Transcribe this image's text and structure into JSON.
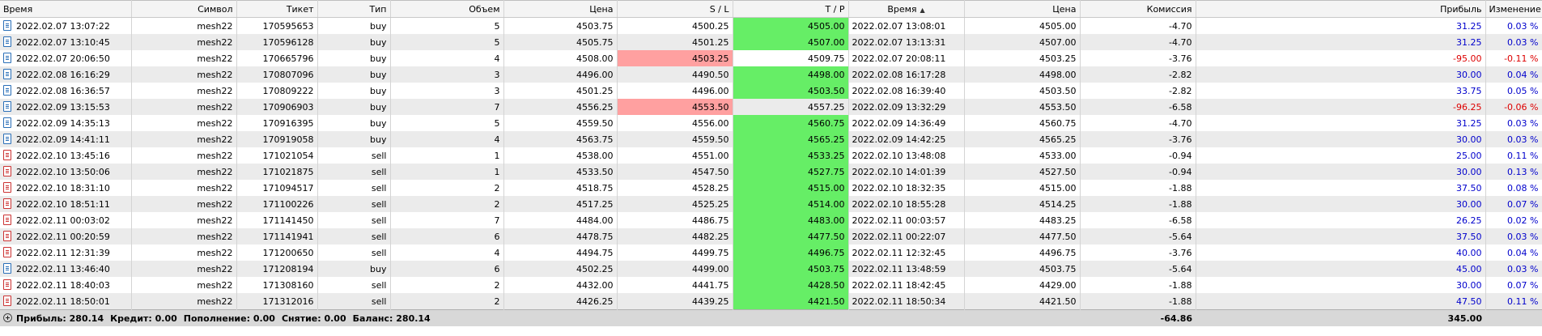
{
  "columns": {
    "time_open": "Время",
    "symbol": "Символ",
    "ticket": "Тикет",
    "type": "Тип",
    "volume": "Объем",
    "price_open": "Цена",
    "sl": "S / L",
    "tp": "T / P",
    "time_close": "Время",
    "price_close": "Цена",
    "commission": "Комиссия",
    "profit": "Прибыль",
    "change": "Изменение"
  },
  "sort": {
    "column": "time_close",
    "direction": "up",
    "icon": "sort-up-icon"
  },
  "rows": [
    {
      "time_open": "2022.02.07 13:07:22",
      "symbol": "mesh22",
      "ticket": "170595653",
      "type": "buy",
      "volume": "5",
      "price_open": "4503.75",
      "sl": "4500.25",
      "tp": "4505.00",
      "time_close": "2022.02.07 13:08:01",
      "price_close": "4505.00",
      "commission": "-4.70",
      "profit": "31.25",
      "change": "0.03 %",
      "hit": "tp"
    },
    {
      "time_open": "2022.02.07 13:10:45",
      "symbol": "mesh22",
      "ticket": "170596128",
      "type": "buy",
      "volume": "5",
      "price_open": "4505.75",
      "sl": "4501.25",
      "tp": "4507.00",
      "time_close": "2022.02.07 13:13:31",
      "price_close": "4507.00",
      "commission": "-4.70",
      "profit": "31.25",
      "change": "0.03 %",
      "hit": "tp"
    },
    {
      "time_open": "2022.02.07 20:06:50",
      "symbol": "mesh22",
      "ticket": "170665796",
      "type": "buy",
      "volume": "4",
      "price_open": "4508.00",
      "sl": "4503.25",
      "tp": "4509.75",
      "time_close": "2022.02.07 20:08:11",
      "price_close": "4503.25",
      "commission": "-3.76",
      "profit": "-95.00",
      "change": "-0.11 %",
      "hit": "sl"
    },
    {
      "time_open": "2022.02.08 16:16:29",
      "symbol": "mesh22",
      "ticket": "170807096",
      "type": "buy",
      "volume": "3",
      "price_open": "4496.00",
      "sl": "4490.50",
      "tp": "4498.00",
      "time_close": "2022.02.08 16:17:28",
      "price_close": "4498.00",
      "commission": "-2.82",
      "profit": "30.00",
      "change": "0.04 %",
      "hit": "tp"
    },
    {
      "time_open": "2022.02.08 16:36:57",
      "symbol": "mesh22",
      "ticket": "170809222",
      "type": "buy",
      "volume": "3",
      "price_open": "4501.25",
      "sl": "4496.00",
      "tp": "4503.50",
      "time_close": "2022.02.08 16:39:40",
      "price_close": "4503.50",
      "commission": "-2.82",
      "profit": "33.75",
      "change": "0.05 %",
      "hit": "tp"
    },
    {
      "time_open": "2022.02.09 13:15:53",
      "symbol": "mesh22",
      "ticket": "170906903",
      "type": "buy",
      "volume": "7",
      "price_open": "4556.25",
      "sl": "4553.50",
      "tp": "4557.25",
      "time_close": "2022.02.09 13:32:29",
      "price_close": "4553.50",
      "commission": "-6.58",
      "profit": "-96.25",
      "change": "-0.06 %",
      "hit": "sl"
    },
    {
      "time_open": "2022.02.09 14:35:13",
      "symbol": "mesh22",
      "ticket": "170916395",
      "type": "buy",
      "volume": "5",
      "price_open": "4559.50",
      "sl": "4556.00",
      "tp": "4560.75",
      "time_close": "2022.02.09 14:36:49",
      "price_close": "4560.75",
      "commission": "-4.70",
      "profit": "31.25",
      "change": "0.03 %",
      "hit": "tp"
    },
    {
      "time_open": "2022.02.09 14:41:11",
      "symbol": "mesh22",
      "ticket": "170919058",
      "type": "buy",
      "volume": "4",
      "price_open": "4563.75",
      "sl": "4559.50",
      "tp": "4565.25",
      "time_close": "2022.02.09 14:42:25",
      "price_close": "4565.25",
      "commission": "-3.76",
      "profit": "30.00",
      "change": "0.03 %",
      "hit": "tp"
    },
    {
      "time_open": "2022.02.10 13:45:16",
      "symbol": "mesh22",
      "ticket": "171021054",
      "type": "sell",
      "volume": "1",
      "price_open": "4538.00",
      "sl": "4551.00",
      "tp": "4533.25",
      "time_close": "2022.02.10 13:48:08",
      "price_close": "4533.00",
      "commission": "-0.94",
      "profit": "25.00",
      "change": "0.11 %",
      "hit": "tp"
    },
    {
      "time_open": "2022.02.10 13:50:06",
      "symbol": "mesh22",
      "ticket": "171021875",
      "type": "sell",
      "volume": "1",
      "price_open": "4533.50",
      "sl": "4547.50",
      "tp": "4527.75",
      "time_close": "2022.02.10 14:01:39",
      "price_close": "4527.50",
      "commission": "-0.94",
      "profit": "30.00",
      "change": "0.13 %",
      "hit": "tp"
    },
    {
      "time_open": "2022.02.10 18:31:10",
      "symbol": "mesh22",
      "ticket": "171094517",
      "type": "sell",
      "volume": "2",
      "price_open": "4518.75",
      "sl": "4528.25",
      "tp": "4515.00",
      "time_close": "2022.02.10 18:32:35",
      "price_close": "4515.00",
      "commission": "-1.88",
      "profit": "37.50",
      "change": "0.08 %",
      "hit": "tp"
    },
    {
      "time_open": "2022.02.10 18:51:11",
      "symbol": "mesh22",
      "ticket": "171100226",
      "type": "sell",
      "volume": "2",
      "price_open": "4517.25",
      "sl": "4525.25",
      "tp": "4514.00",
      "time_close": "2022.02.10 18:55:28",
      "price_close": "4514.25",
      "commission": "-1.88",
      "profit": "30.00",
      "change": "0.07 %",
      "hit": "tp"
    },
    {
      "time_open": "2022.02.11 00:03:02",
      "symbol": "mesh22",
      "ticket": "171141450",
      "type": "sell",
      "volume": "7",
      "price_open": "4484.00",
      "sl": "4486.75",
      "tp": "4483.00",
      "time_close": "2022.02.11 00:03:57",
      "price_close": "4483.25",
      "commission": "-6.58",
      "profit": "26.25",
      "change": "0.02 %",
      "hit": "tp"
    },
    {
      "time_open": "2022.02.11 00:20:59",
      "symbol": "mesh22",
      "ticket": "171141941",
      "type": "sell",
      "volume": "6",
      "price_open": "4478.75",
      "sl": "4482.25",
      "tp": "4477.50",
      "time_close": "2022.02.11 00:22:07",
      "price_close": "4477.50",
      "commission": "-5.64",
      "profit": "37.50",
      "change": "0.03 %",
      "hit": "tp"
    },
    {
      "time_open": "2022.02.11 12:31:39",
      "symbol": "mesh22",
      "ticket": "171200650",
      "type": "sell",
      "volume": "4",
      "price_open": "4494.75",
      "sl": "4499.75",
      "tp": "4496.75",
      "time_close": "2022.02.11 12:32:45",
      "price_close": "4496.75",
      "commission": "-3.76",
      "profit": "40.00",
      "change": "0.04 %",
      "hit": "tp"
    },
    {
      "time_open": "2022.02.11 13:46:40",
      "symbol": "mesh22",
      "ticket": "171208194",
      "type": "buy",
      "volume": "6",
      "price_open": "4502.25",
      "sl": "4499.00",
      "tp": "4503.75",
      "time_close": "2022.02.11 13:48:59",
      "price_close": "4503.75",
      "commission": "-5.64",
      "profit": "45.00",
      "change": "0.03 %",
      "hit": "tp"
    },
    {
      "time_open": "2022.02.11 18:40:03",
      "symbol": "mesh22",
      "ticket": "171308160",
      "type": "sell",
      "volume": "2",
      "price_open": "4432.00",
      "sl": "4441.75",
      "tp": "4428.50",
      "time_close": "2022.02.11 18:42:45",
      "price_close": "4429.00",
      "commission": "-1.88",
      "profit": "30.00",
      "change": "0.07 %",
      "hit": "tp"
    },
    {
      "time_open": "2022.02.11 18:50:01",
      "symbol": "mesh22",
      "ticket": "171312016",
      "type": "sell",
      "volume": "2",
      "price_open": "4426.25",
      "sl": "4439.25",
      "tp": "4421.50",
      "time_close": "2022.02.11 18:50:34",
      "price_close": "4421.50",
      "commission": "-1.88",
      "profit": "47.50",
      "change": "0.11 %",
      "hit": "tp"
    }
  ],
  "footer": {
    "profit": "Прибыль: 280.14",
    "credit": "Кредит: 0.00",
    "deposit": "Пополнение: 0.00",
    "withdrawal": "Снятие: 0.00",
    "balance": "Баланс: 280.14",
    "commission_total": "-64.86",
    "profit_total": "345.00"
  },
  "colors": {
    "sl_hit": "#ffa0a0",
    "tp_hit": "#66ee66",
    "profit_positive": "#0000cc",
    "profit_negative": "#dd0000",
    "buy_icon": "#2a6fb8",
    "sell_icon": "#cc3333"
  }
}
